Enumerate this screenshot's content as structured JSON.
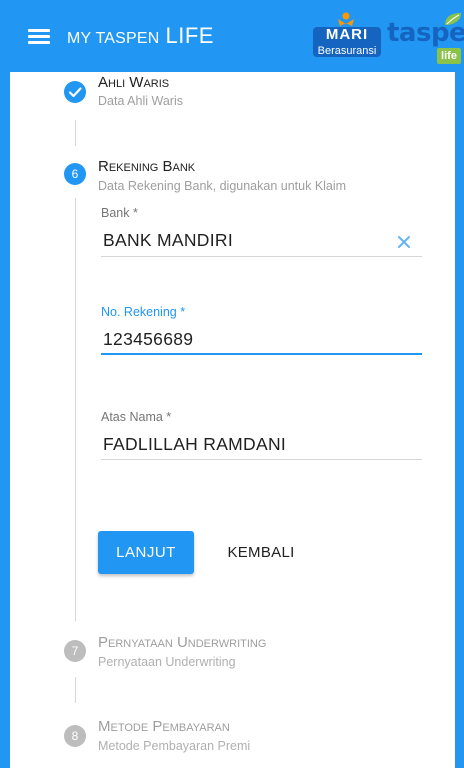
{
  "header": {
    "title_prefix": "MY TASPEN",
    "title_suffix": "LIFE",
    "mari_logo_text": "MARI",
    "mari_logo_sub": "Berasuransi",
    "brand_logo_text": "taspen",
    "brand_logo_badge": "life",
    "background_color": "#2196f3"
  },
  "stepper": {
    "steps": [
      {
        "number": "",
        "title": "Ahli Waris",
        "subtitle": "Data Ahli Waris",
        "state": "completed",
        "icon": "check-icon"
      },
      {
        "number": "6",
        "title": "Rekening Bank",
        "subtitle": "Data Rekening Bank, digunakan untuk Klaim",
        "state": "active"
      },
      {
        "number": "7",
        "title": "Pernyataan Underwriting",
        "subtitle": "Pernyataan Underwriting",
        "state": "pending"
      },
      {
        "number": "8",
        "title": "Metode Pembayaran",
        "subtitle": "Metode Pembayaran Premi",
        "state": "pending"
      }
    ]
  },
  "form": {
    "bank": {
      "label": "Bank *",
      "value": "BANK MANDIRI",
      "clear_icon": "close-icon"
    },
    "account_number": {
      "label": "No. Rekening *",
      "value": "123456689",
      "focused": true
    },
    "account_name": {
      "label": "Atas Nama *",
      "value": "FADLILLAH RAMDANI"
    }
  },
  "actions": {
    "next_label": "LANJUT",
    "back_label": "KEMBALI"
  },
  "colors": {
    "accent": "#2196f3",
    "pending": "#bdbdbd",
    "text": "#212121",
    "hint": "#9e9e9e"
  }
}
